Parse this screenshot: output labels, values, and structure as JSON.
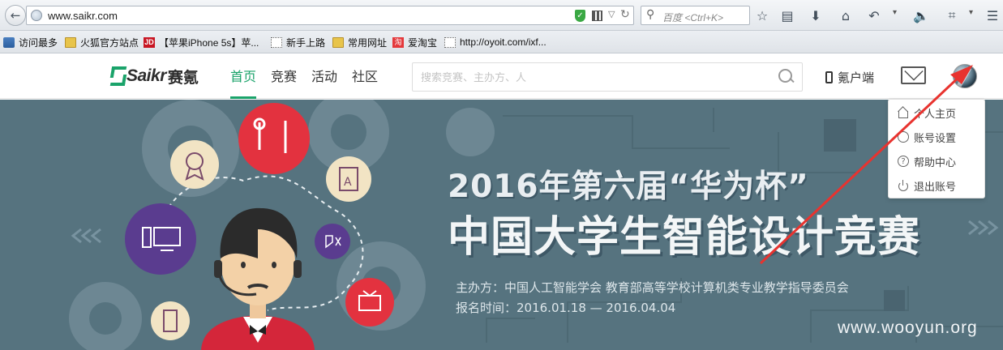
{
  "browser": {
    "url": "www.saikr.com",
    "search_placeholder": "百度 <Ctrl+K>",
    "toolbar_icons": [
      "star-icon",
      "reading-list-icon",
      "download-icon",
      "home-icon",
      "undo-icon",
      "volume-icon",
      "crop-icon"
    ],
    "bookmarks": [
      {
        "label": "访问最多",
        "icon": "most-visited-icon"
      },
      {
        "label": "火狐官方站点",
        "icon": "folder-icon"
      },
      {
        "label": "【苹果iPhone 5s】苹...",
        "icon": "jd-icon"
      },
      {
        "label": "新手上路",
        "icon": "blank-page-icon"
      },
      {
        "label": "常用网址",
        "icon": "folder-icon"
      },
      {
        "label": "爱淘宝",
        "icon": "taobao-icon"
      },
      {
        "label": "http://oyoit.com/ixf...",
        "icon": "blank-page-icon"
      }
    ]
  },
  "site": {
    "logo_text": "Saikr",
    "logo_cn": "赛氪",
    "nav": [
      {
        "label": "首页",
        "active": true
      },
      {
        "label": "竞赛",
        "active": false
      },
      {
        "label": "活动",
        "active": false
      },
      {
        "label": "社区",
        "active": false
      }
    ],
    "search_placeholder": "搜索竞赛、主办方、人",
    "client_label": "氪户端",
    "accent_color": "#1aa36a"
  },
  "banner": {
    "title_line1": "2016年第六届“华为杯”",
    "title_line2": "中国大学生智能设计竞赛",
    "organizer": "主办方：中国人工智能学会   教育部高等学校计算机类专业教学指导委员会",
    "date": "报名时间：2016.01.18 — 2016.04.04",
    "background_color": "#56737f"
  },
  "user_menu": {
    "items": [
      {
        "label": "个人主页",
        "icon": "home-icon"
      },
      {
        "label": "账号设置",
        "icon": "gear-icon"
      },
      {
        "label": "帮助中心",
        "icon": "help-icon"
      },
      {
        "label": "退出账号",
        "icon": "logout-icon"
      }
    ]
  },
  "watermark": "www.wooyun.org",
  "annotation_color": "#e8332f"
}
